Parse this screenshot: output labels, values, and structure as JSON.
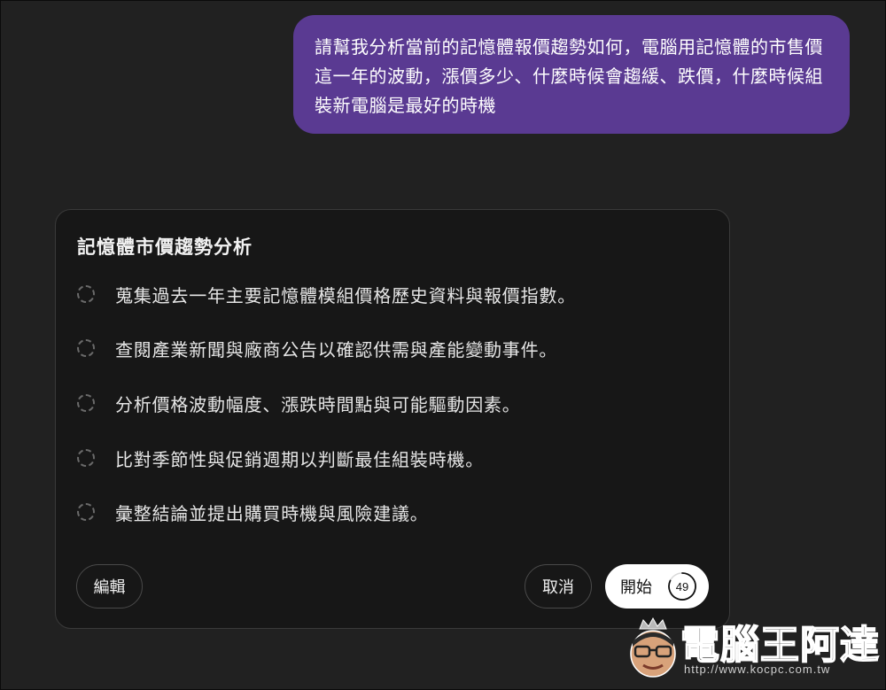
{
  "conversation": {
    "user_message": "請幫我分析當前的記憶體報價趨勢如何，電腦用記憶體的市售價這一年的波動，漲價多少、什麼時候會趨緩、跌價，什麼時候組裝新電腦是最好的時機"
  },
  "plan_card": {
    "title": "記憶體市價趨勢分析",
    "steps": [
      {
        "text": "蒐集過去一年主要記憶體模組價格歷史資料與報價指數。"
      },
      {
        "text": "查閱產業新聞與廠商公告以確認供需與產能變動事件。"
      },
      {
        "text": "分析價格波動幅度、漲跌時間點與可能驅動因素。"
      },
      {
        "text": "比對季節性與促銷週期以判斷最佳組裝時機。"
      },
      {
        "text": "彙整結論並提出購買時機與風險建議。"
      }
    ],
    "buttons": {
      "edit": "編輯",
      "cancel": "取消",
      "start": "開始",
      "countdown": "49"
    }
  },
  "watermark": {
    "title": "電腦王阿達",
    "url": "http://www.kocpc.com.tw"
  },
  "colors": {
    "background": "#212121",
    "user_bubble": "#5a3a92",
    "card": "#171717",
    "start_button": "#ffffff"
  }
}
